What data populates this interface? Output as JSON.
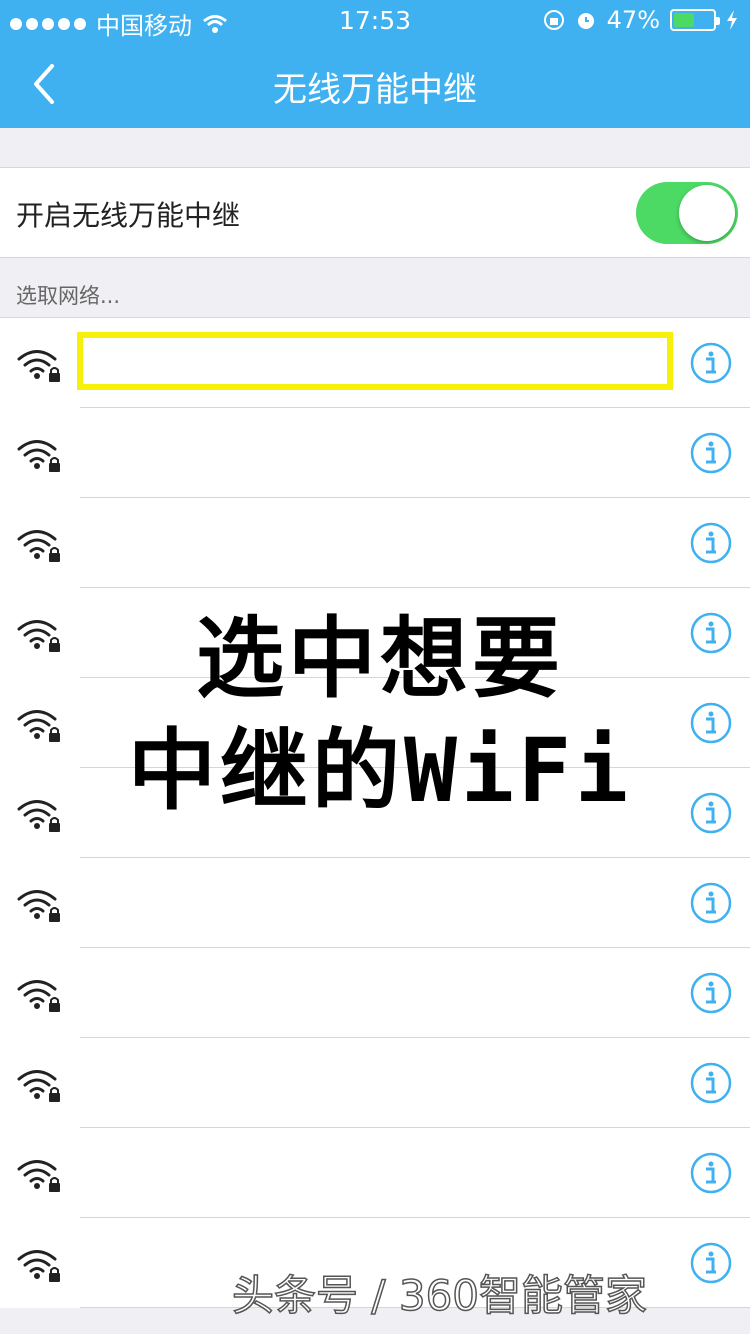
{
  "status_bar": {
    "carrier": "中国移动",
    "time": "17:53",
    "battery_percent": "47%",
    "battery_level": 0.47
  },
  "nav": {
    "title": "无线万能中继",
    "back_icon": "chevron-left-icon"
  },
  "toggle": {
    "label": "开启无线万能中继",
    "on": true
  },
  "section": {
    "label": "选取网络..."
  },
  "networks": [
    {
      "name": "",
      "selected": true
    },
    {
      "name": ""
    },
    {
      "name": ""
    },
    {
      "name": ""
    },
    {
      "name": ""
    },
    {
      "name": ""
    },
    {
      "name": ""
    },
    {
      "name": ""
    },
    {
      "name": ""
    },
    {
      "name": ""
    },
    {
      "name": ""
    }
  ],
  "overlay": {
    "line1": "选中想要",
    "line2": "中继的WiFi"
  },
  "watermark": "头条号 / 360智能管家",
  "colors": {
    "header": "#3fb1f1",
    "toggle_on": "#4cd964",
    "info_icon": "#3fb1f1",
    "highlight": "#f7f00a"
  }
}
